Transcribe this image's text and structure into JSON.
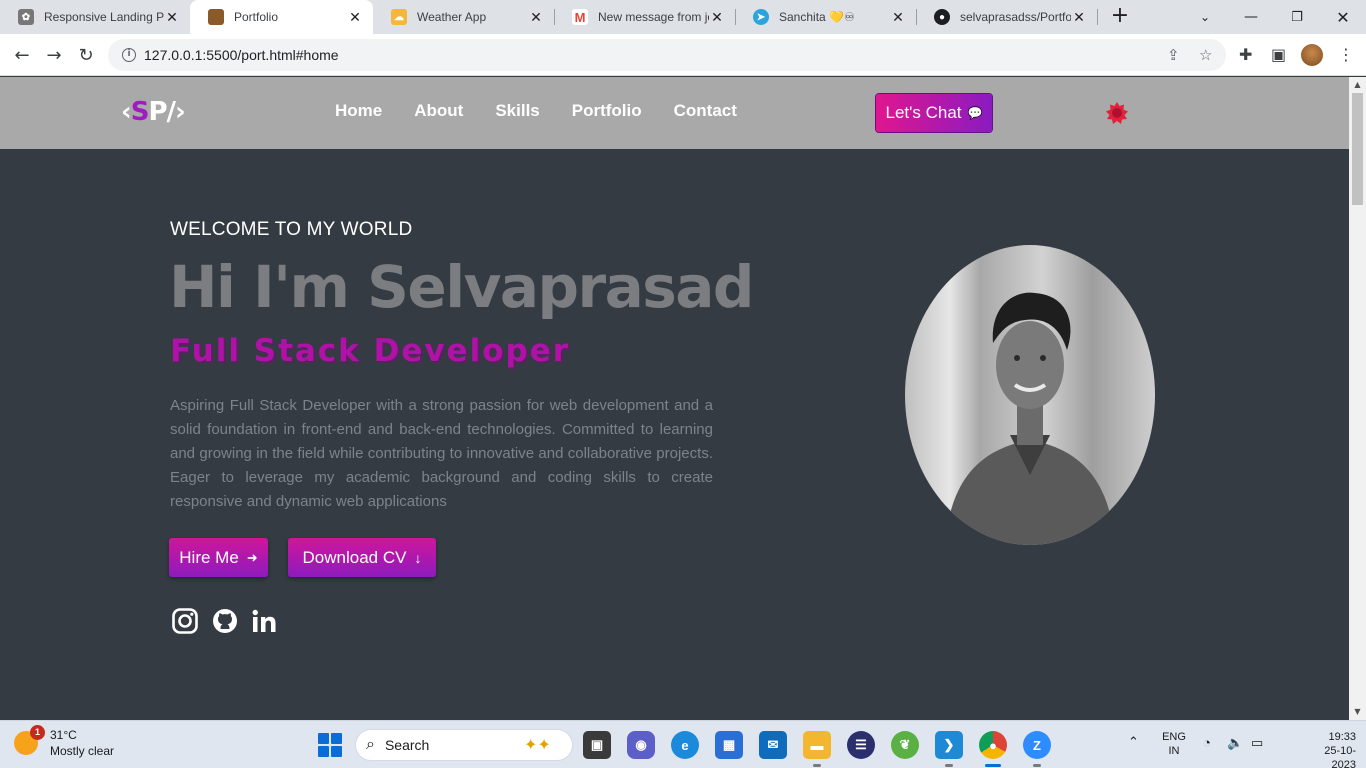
{
  "browser": {
    "tabs": [
      {
        "title": "Responsive Landing P",
        "favicon": "paw-icon",
        "color": "#6b6b6b",
        "active": false
      },
      {
        "title": "Portfolio",
        "favicon": "portrait-icon",
        "color": "#8a5a2b",
        "active": true
      },
      {
        "title": "Weather App",
        "favicon": "weather-icon",
        "color": "#f5b73b",
        "active": false
      },
      {
        "title": "New message from je",
        "favicon": "gmail-icon",
        "color": "#ea4335",
        "active": false
      },
      {
        "title": "Sanchita 💛♾",
        "favicon": "telegram-icon",
        "color": "#2aa3df",
        "active": false
      },
      {
        "title": "selvaprasadss/Portfol",
        "favicon": "github-icon",
        "color": "#1b1f23",
        "active": false
      }
    ],
    "url": "127.0.0.1:5500/port.html#home"
  },
  "site": {
    "logo": {
      "left": "‹",
      "s": "S",
      "p": "P",
      "right": "/›"
    },
    "nav": [
      "Home",
      "About",
      "Skills",
      "Portfolio",
      "Contact"
    ],
    "chat_button": "Let's Chat",
    "hero": {
      "kicker": "WELCOME TO MY WORLD",
      "title": "Hi I'm Selvaprasad",
      "role": "Full Stack Developer",
      "description": "Aspiring Full Stack Developer with a strong passion for web development and a solid foundation in front-end and back-end technologies. Committed to learning and growing in the field while contributing to innovative and collaborative projects. Eager to leverage my academic background and coding skills to create responsive and dynamic web applications",
      "hire_button": "Hire Me",
      "cv_button": "Download CV"
    },
    "social": [
      "instagram-icon",
      "github-icon",
      "linkedin-icon"
    ],
    "colors": {
      "accent_pink": "#e0168f",
      "accent_purple": "#8a1bc1",
      "page_bg": "#353b43",
      "header_bg": "#a9a9a9"
    }
  },
  "taskbar": {
    "weather": {
      "temp": "31°C",
      "condition": "Mostly clear",
      "badge": "1"
    },
    "search_placeholder": "Search",
    "language": {
      "line1": "ENG",
      "line2": "IN"
    },
    "clock": {
      "time": "19:33",
      "date": "25-10-2023"
    }
  }
}
